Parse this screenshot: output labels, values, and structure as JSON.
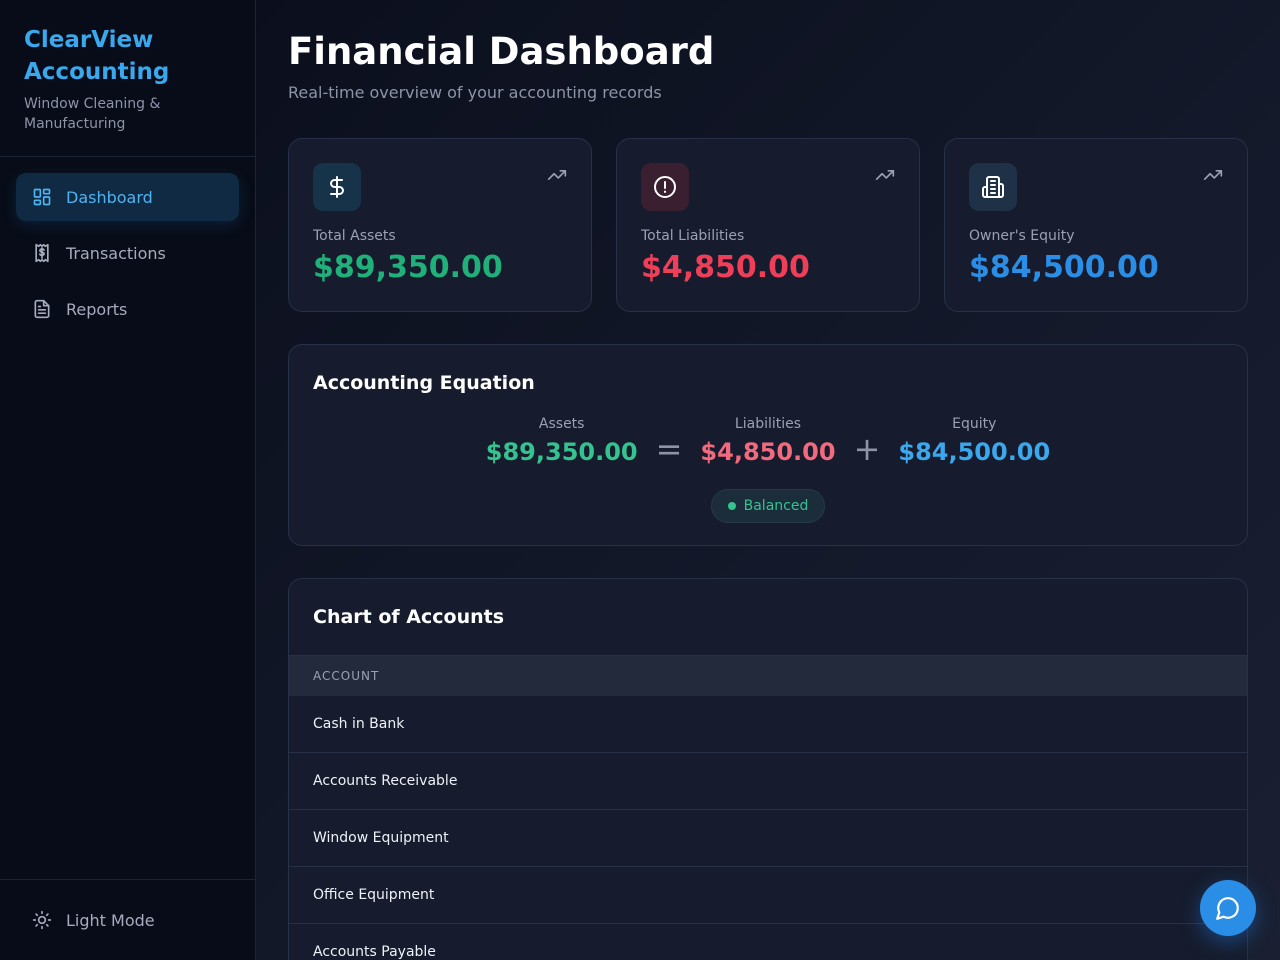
{
  "brand": {
    "title": "ClearView Accounting",
    "subtitle": "Window Cleaning & Manufacturing"
  },
  "nav": {
    "items": [
      {
        "label": "Dashboard",
        "icon": "dashboard-icon",
        "active": true
      },
      {
        "label": "Transactions",
        "icon": "receipt-icon",
        "active": false
      },
      {
        "label": "Reports",
        "icon": "document-icon",
        "active": false
      }
    ],
    "footer_label": "Light Mode",
    "footer_icon": "sun-icon"
  },
  "header": {
    "title": "Financial Dashboard",
    "subtitle": "Real-time overview of your accounting records"
  },
  "stats": [
    {
      "label": "Total Assets",
      "value": "$89,350.00",
      "icon": "dollar-icon",
      "color": "#20b07a"
    },
    {
      "label": "Total Liabilities",
      "value": "$4,850.00",
      "icon": "alert-circle-icon",
      "color": "#ef3f58"
    },
    {
      "label": "Owner's Equity",
      "value": "$84,500.00",
      "icon": "building-icon",
      "color": "#2b8ee6"
    }
  ],
  "equation": {
    "title": "Accounting Equation",
    "assets_label": "Assets",
    "assets_value": "$89,350.00",
    "equals": "=",
    "liabilities_label": "Liabilities",
    "liabilities_value": "$4,850.00",
    "plus": "+",
    "equity_label": "Equity",
    "equity_value": "$84,500.00",
    "status": "Balanced"
  },
  "accounts": {
    "title": "Chart of Accounts",
    "column_header": "ACCOUNT",
    "rows": [
      "Cash in Bank",
      "Accounts Receivable",
      "Window Equipment",
      "Office Equipment",
      "Accounts Payable"
    ]
  },
  "colors": {
    "accent": "#3aa8ec",
    "positive": "#34c38f",
    "negative": "#ef3f58",
    "equity": "#2b8ee6"
  }
}
